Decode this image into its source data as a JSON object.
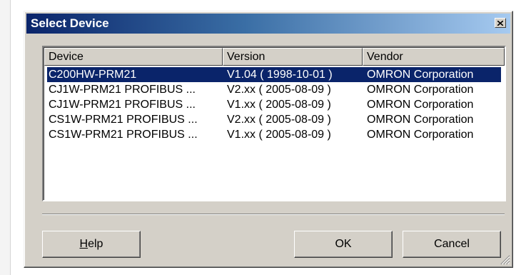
{
  "dialog": {
    "title": "Select Device",
    "close_icon": "close-icon"
  },
  "list": {
    "columns": [
      "Device",
      "Version",
      "Vendor"
    ],
    "rows": [
      {
        "device": "C200HW-PRM21",
        "version": "V1.04 ( 1998-10-01 )",
        "vendor": "OMRON Corporation",
        "selected": true
      },
      {
        "device": "CJ1W-PRM21 PROFIBUS ...",
        "version": "V2.xx ( 2005-08-09 )",
        "vendor": "OMRON Corporation",
        "selected": false
      },
      {
        "device": "CJ1W-PRM21 PROFIBUS ...",
        "version": "V1.xx ( 2005-08-09 )",
        "vendor": "OMRON Corporation",
        "selected": false
      },
      {
        "device": "CS1W-PRM21 PROFIBUS ...",
        "version": "V2.xx ( 2005-08-09 )",
        "vendor": "OMRON Corporation",
        "selected": false
      },
      {
        "device": "CS1W-PRM21 PROFIBUS ...",
        "version": "V1.xx ( 2005-08-09 )",
        "vendor": "OMRON Corporation",
        "selected": false
      }
    ]
  },
  "buttons": {
    "help": "Help",
    "ok": "OK",
    "cancel": "Cancel"
  },
  "colors": {
    "titlebar_start": "#0a246a",
    "titlebar_end": "#a6caf0",
    "selection": "#0a246a",
    "face": "#d4d0c8"
  }
}
